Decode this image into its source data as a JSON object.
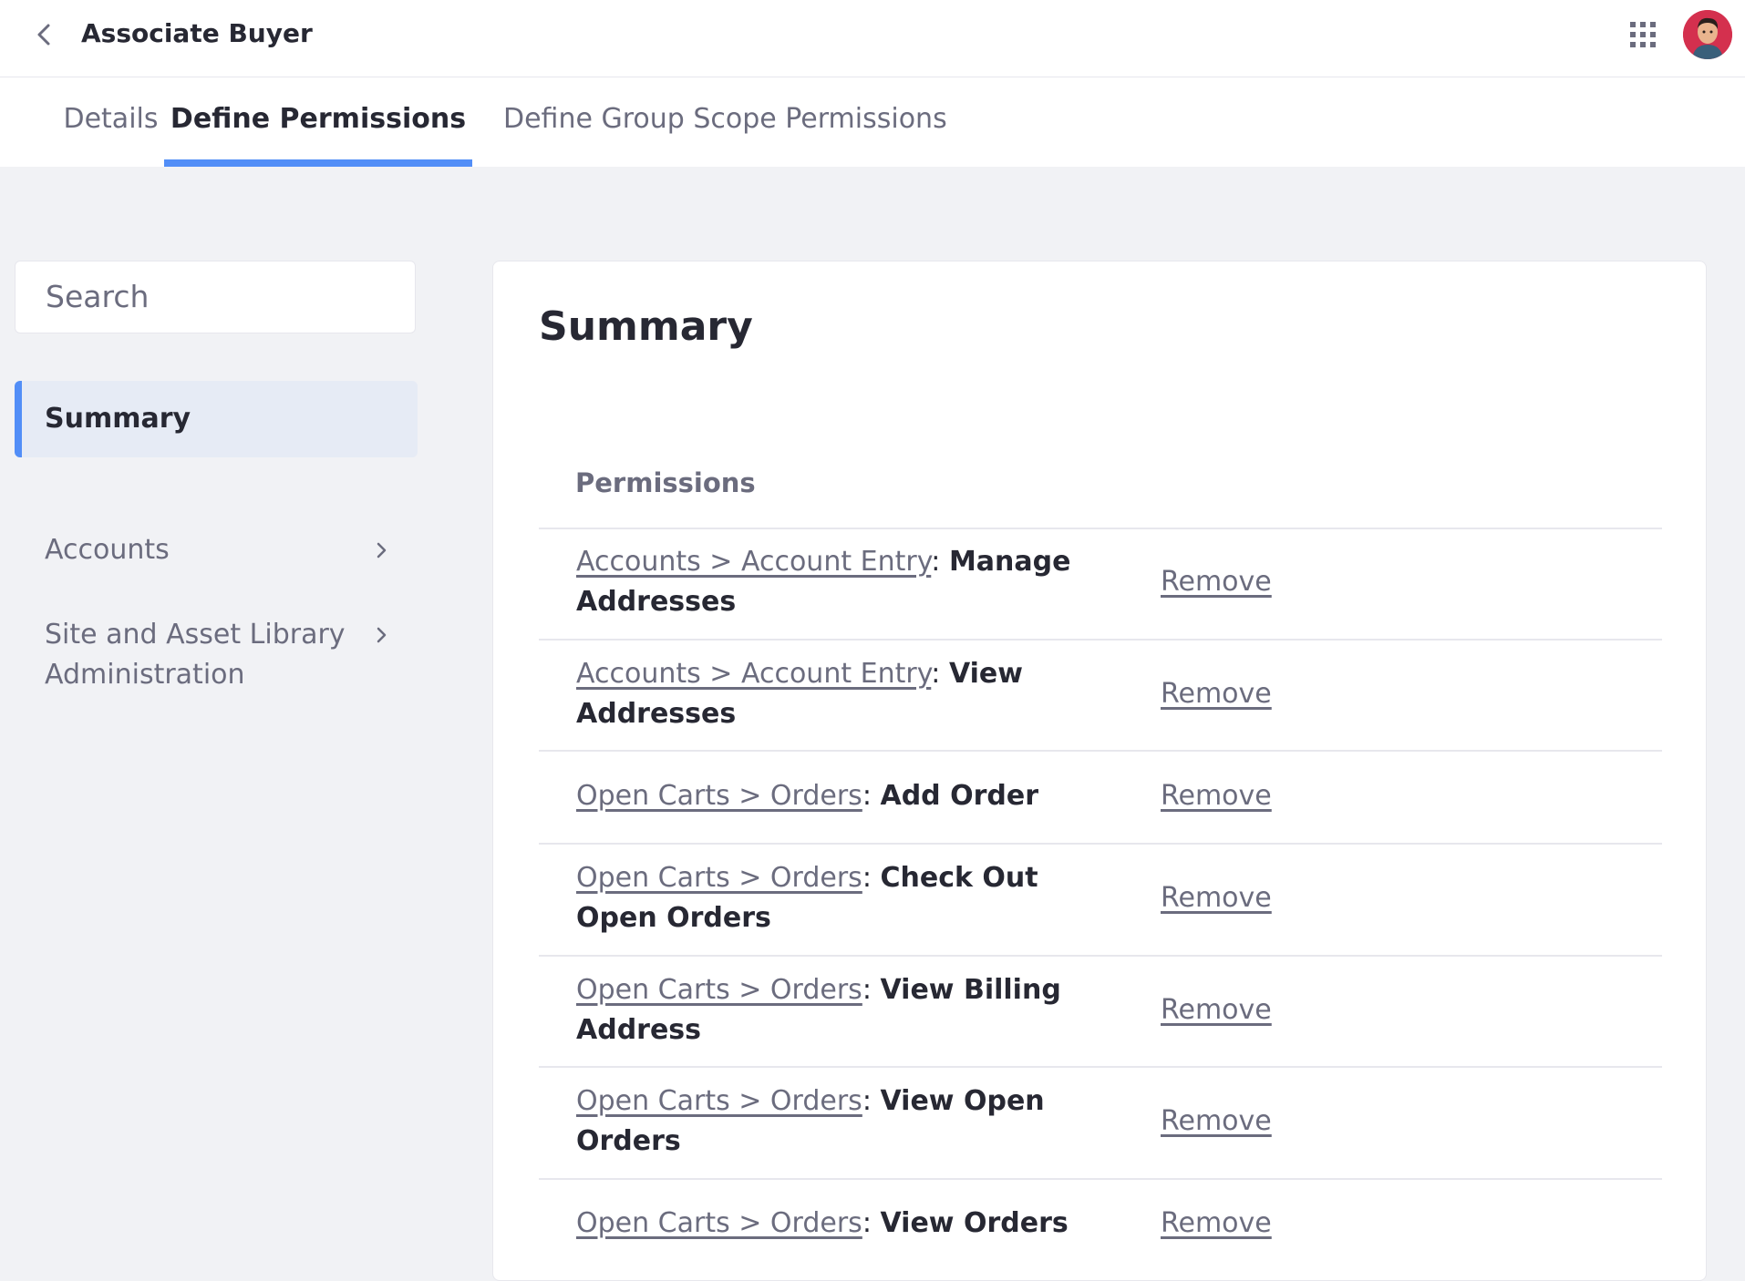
{
  "header": {
    "title": "Associate Buyer",
    "back_icon": "chevron-left-icon",
    "apps_icon": "grid-icon",
    "avatar": "user-avatar"
  },
  "tabs": [
    {
      "label": "Details",
      "active": false
    },
    {
      "label": "Define Permissions",
      "active": true
    },
    {
      "label": "Define Group Scope Permissions",
      "active": false
    }
  ],
  "sidebar": {
    "search_placeholder": "Search",
    "items": [
      {
        "label": "Summary",
        "active": true
      },
      {
        "label": "Accounts",
        "has_children": true
      },
      {
        "label": "Site and Asset Library Administration",
        "has_children": true
      }
    ]
  },
  "summary": {
    "title": "Summary",
    "column_header": "Permissions",
    "remove_label": "Remove",
    "rows": [
      {
        "path": "Accounts > Account Entry",
        "action": "Manage Addresses"
      },
      {
        "path": "Accounts > Account Entry",
        "action": "View Addresses"
      },
      {
        "path": "Open Carts > Orders",
        "action": "Add Order"
      },
      {
        "path": "Open Carts > Orders",
        "action": "Check Out Open Orders"
      },
      {
        "path": "Open Carts > Orders",
        "action": "View Billing Address"
      },
      {
        "path": "Open Carts > Orders",
        "action": "View Open Orders"
      },
      {
        "path": "Open Carts > Orders",
        "action": "View Orders"
      }
    ]
  },
  "colors": {
    "accent": "#528ef7",
    "background": "#f1f2f5",
    "text_primary": "#272833",
    "text_secondary": "#6b6c7e"
  }
}
